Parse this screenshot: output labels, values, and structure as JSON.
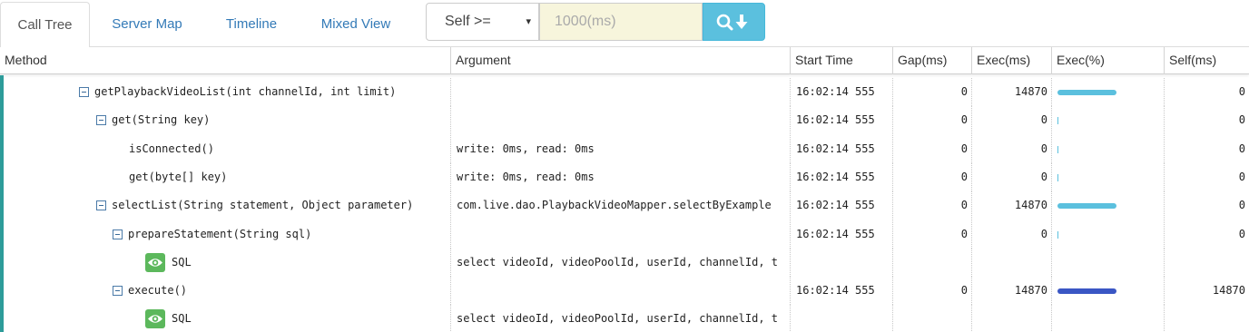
{
  "tabs": [
    {
      "label": "Call Tree",
      "active": true
    },
    {
      "label": "Server Map",
      "active": false
    },
    {
      "label": "Timeline",
      "active": false
    },
    {
      "label": "Mixed View",
      "active": false
    }
  ],
  "filter": {
    "select_value": "Self >=",
    "caret": "▾",
    "input_placeholder": "1000(ms)",
    "search_icon": "search-download-icon"
  },
  "columns": [
    "Method",
    "Argument",
    "Start Time",
    "Gap(ms)",
    "Exec(ms)",
    "Exec(%)",
    "Self(ms)"
  ],
  "rows": [
    {
      "depth": 0,
      "toggle": true,
      "sql_icon": false,
      "method": "getPlaybackVideoList(int channelId, int limit)",
      "argument": "",
      "start": "16:02:14 555",
      "gap": "0",
      "exec": "14870",
      "exec_pct": 100,
      "self": "0",
      "bar_color": "#5bc0de"
    },
    {
      "depth": 1,
      "toggle": true,
      "sql_icon": false,
      "method": "get(String key)",
      "argument": "",
      "start": "16:02:14 555",
      "gap": "0",
      "exec": "0",
      "exec_pct": 0,
      "self": "0",
      "bar_color": "#5bc0de"
    },
    {
      "depth": 2,
      "toggle": false,
      "sql_icon": false,
      "method": "isConnected()",
      "argument": "write: 0ms, read: 0ms",
      "start": "16:02:14 555",
      "gap": "0",
      "exec": "0",
      "exec_pct": 0,
      "self": "0",
      "bar_color": "#5bc0de"
    },
    {
      "depth": 2,
      "toggle": false,
      "sql_icon": false,
      "method": "get(byte[] key)",
      "argument": "write: 0ms, read: 0ms",
      "start": "16:02:14 555",
      "gap": "0",
      "exec": "0",
      "exec_pct": 0,
      "self": "0",
      "bar_color": "#5bc0de"
    },
    {
      "depth": 1,
      "toggle": true,
      "sql_icon": false,
      "method": "selectList(String statement, Object parameter)",
      "argument": "com.live.dao.PlaybackVideoMapper.selectByExample",
      "start": "16:02:14 555",
      "gap": "0",
      "exec": "14870",
      "exec_pct": 100,
      "self": "0",
      "bar_color": "#5bc0de"
    },
    {
      "depth": 2,
      "toggle": true,
      "sql_icon": false,
      "method": "prepareStatement(String sql)",
      "argument": "",
      "start": "16:02:14 555",
      "gap": "0",
      "exec": "0",
      "exec_pct": 0,
      "self": "0",
      "bar_color": "#5bc0de"
    },
    {
      "depth": 3,
      "toggle": false,
      "sql_icon": true,
      "method": "SQL",
      "argument": "select videoId, videoPoolId, userId, channelId, t",
      "start": "",
      "gap": "",
      "exec": "",
      "exec_pct": null,
      "self": "",
      "bar_color": ""
    },
    {
      "depth": 2,
      "toggle": true,
      "sql_icon": false,
      "method": "execute()",
      "argument": "",
      "start": "16:02:14 555",
      "gap": "0",
      "exec": "14870",
      "exec_pct": 100,
      "self": "14870",
      "bar_color": "#3a56c4"
    },
    {
      "depth": 3,
      "toggle": false,
      "sql_icon": true,
      "method": "SQL",
      "argument": "select videoId, videoPoolId, userId, channelId, t",
      "start": "",
      "gap": "",
      "exec": "",
      "exec_pct": null,
      "self": "",
      "bar_color": ""
    }
  ]
}
